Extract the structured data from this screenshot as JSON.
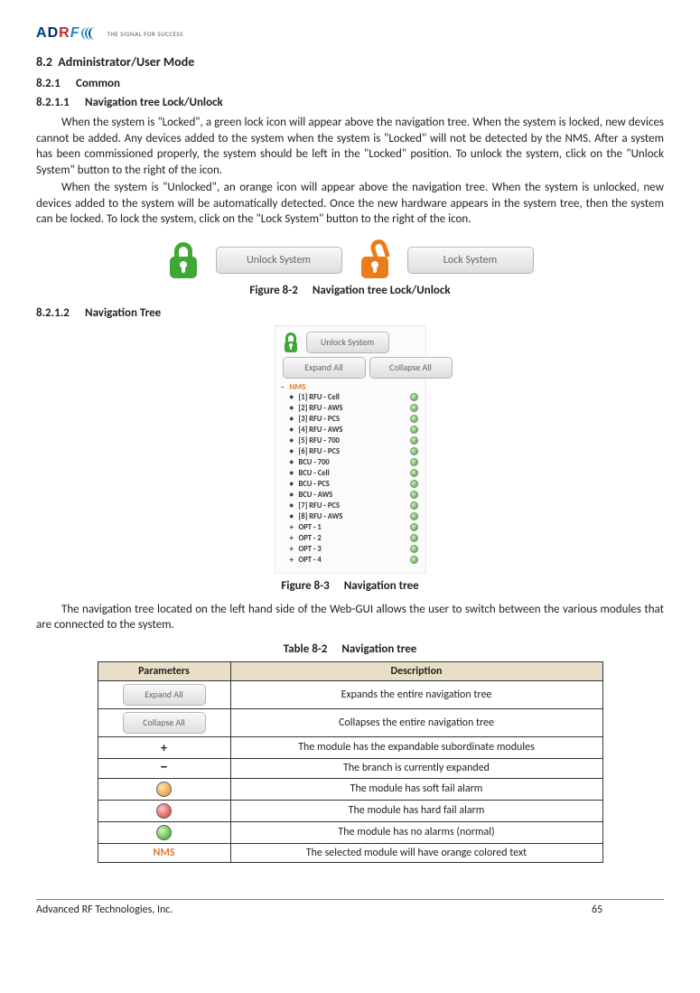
{
  "logo": {
    "tagline": "THE SIGNAL FOR SUCCESS"
  },
  "headings": {
    "h2_num": "8.2",
    "h2_title": "Administrator/User Mode",
    "h3_num": "8.2.1",
    "h3_title": "Common",
    "h4a_num": "8.2.1.1",
    "h4a_title": "Navigation tree Lock/Unlock",
    "h4b_num": "8.2.1.2",
    "h4b_title": "Navigation Tree"
  },
  "paragraphs": {
    "p1": "When the system is \"Locked\", a green lock icon will appear above the navigation tree.  When the system is locked, new devices cannot be added.  Any devices added to the system when the system is \"Locked\" will not be detected by the NMS.  After a system has been commissioned properly, the system should be left in the \"Locked\" position.  To unlock the system, click on the \"Unlock System\" button to the right of the icon.",
    "p2": "When the system is \"Unlocked\", an orange icon will appear above the navigation tree.  When the system is unlocked, new devices added to the system will be automatically detected.  Once the new hardware appears in the system tree, then the system can be locked.  To lock the system, click on the \"Lock System\" button to the right of the icon.",
    "p3": "The navigation tree located on the left hand side of the Web-GUI allows the user to switch between the various modules that are connected to the system."
  },
  "buttons": {
    "unlock": "Unlock System",
    "lock": "Lock System",
    "expand": "Expand All",
    "collapse": "Collapse All"
  },
  "fig1": {
    "label": "Figure 8-2",
    "caption": "Navigation tree Lock/Unlock"
  },
  "tree": {
    "root": "NMS",
    "items": [
      {
        "pm": "•",
        "label": "[1] RFU - Cell"
      },
      {
        "pm": "•",
        "label": "[2] RFU - AWS"
      },
      {
        "pm": "•",
        "label": "[3] RFU - PCS"
      },
      {
        "pm": "•",
        "label": "[4] RFU - AWS"
      },
      {
        "pm": "•",
        "label": "[5] RFU - 700"
      },
      {
        "pm": "•",
        "label": "[6] RFU - PCS"
      },
      {
        "pm": "•",
        "label": "BCU - 700"
      },
      {
        "pm": "•",
        "label": "BCU - Cell"
      },
      {
        "pm": "•",
        "label": "BCU - PCS"
      },
      {
        "pm": "•",
        "label": "BCU - AWS"
      },
      {
        "pm": "•",
        "label": "[7] RFU - PCS"
      },
      {
        "pm": "•",
        "label": "[8] RFU - AWS"
      },
      {
        "pm": "+",
        "label": "OPT - 1"
      },
      {
        "pm": "+",
        "label": "OPT - 2"
      },
      {
        "pm": "+",
        "label": "OPT - 3"
      },
      {
        "pm": "+",
        "label": "OPT - 4"
      }
    ]
  },
  "fig2": {
    "label": "Figure 8-3",
    "caption": "Navigation tree"
  },
  "tbl": {
    "label": "Table 8-2",
    "caption": "Navigation tree",
    "head_param": "Parameters",
    "head_desc": "Description",
    "rows": {
      "r1": "Expands the entire navigation tree",
      "r2": "Collapses the entire navigation tree",
      "r3": "The module has the expandable subordinate modules",
      "r4": "The branch is currently expanded",
      "r5": "The module has soft fail alarm",
      "r6": "The module has hard fail alarm",
      "r7": "The module has no alarms (normal)",
      "r8": "The selected module will have orange colored text"
    },
    "nms": "NMS"
  },
  "footer": {
    "company": "Advanced RF Technologies, Inc.",
    "page": "65"
  }
}
